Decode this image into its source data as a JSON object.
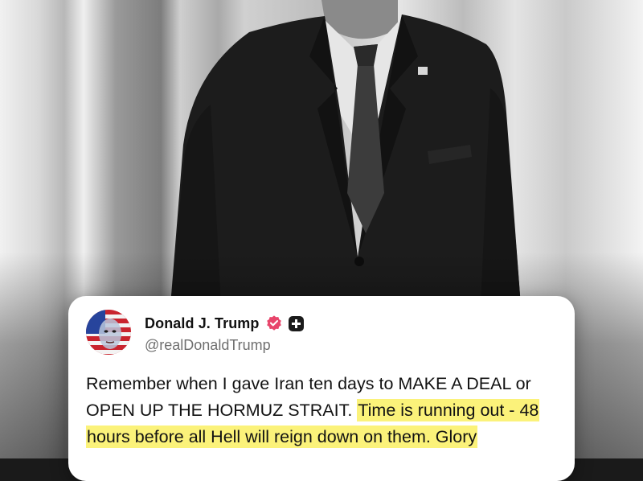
{
  "post": {
    "author_name": "Donald J. Trump",
    "handle": "@realDonaldTrump",
    "text_plain": "Remember when I gave Iran ten days to MAKE A DEAL or OPEN UP THE HORMUZ STRAIT.",
    "text_highlighted": "Time is running out - 48 hours before all Hell will reign down on them. Glory"
  },
  "icons": {
    "verified": "verified-badge-icon",
    "plus": "plus-icon",
    "avatar": "avatar-flag-face"
  },
  "colors": {
    "highlight": "#fbf27a",
    "verified_badge": "#e8456b",
    "card_bg": "#ffffff",
    "text": "#121212",
    "handle": "#6f6f6f"
  }
}
